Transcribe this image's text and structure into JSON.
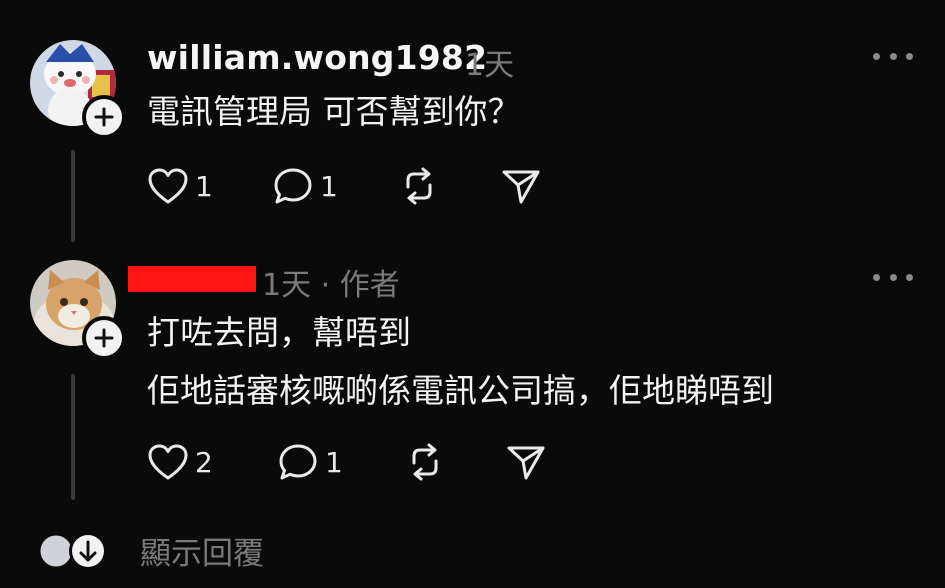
{
  "posts": [
    {
      "username": "william.wong1982",
      "time": "1天",
      "lines": [
        "電訊管理局 可否幫到你？"
      ],
      "likes": "1",
      "replies": "1",
      "avatar_icon": "mascot-avatar-icon"
    },
    {
      "username": "",
      "time": "1天 · 作者",
      "lines": [
        "打咗去問，幫唔到",
        "佢地話審核嘅啲係電訊公司搞，佢地睇唔到"
      ],
      "likes": "2",
      "replies": "1",
      "avatar_icon": "cat-avatar-icon"
    }
  ],
  "footer": {
    "show_replies_label": "顯示回覆"
  },
  "colors": {
    "background": "#0a0a0a",
    "text": "#f3f3f3",
    "muted": "#7a7a7a",
    "redaction": "#ff1414"
  }
}
